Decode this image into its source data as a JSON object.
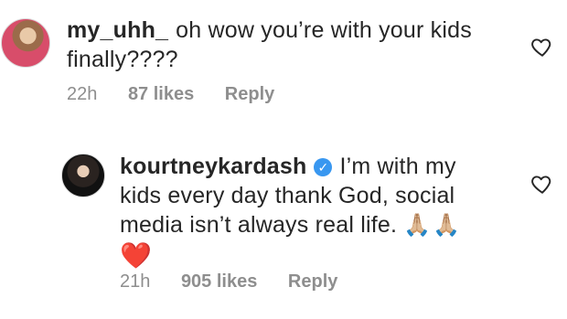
{
  "comments": [
    {
      "username": "my_uhh_",
      "text": "oh wow you’re with your kids finally????",
      "time": "22h",
      "likes": "87 likes",
      "reply": "Reply"
    },
    {
      "username": "kourtneykardash",
      "verified": true,
      "text": "I’m with my kids every day thank God, social media isn’t always real life.",
      "emoji": "🙏🏼🙏🏼",
      "heart": "❤️",
      "time": "21h",
      "likes": "905 likes",
      "reply": "Reply"
    }
  ],
  "icons": {
    "verified": "✓",
    "like": "heart-outline-icon"
  }
}
